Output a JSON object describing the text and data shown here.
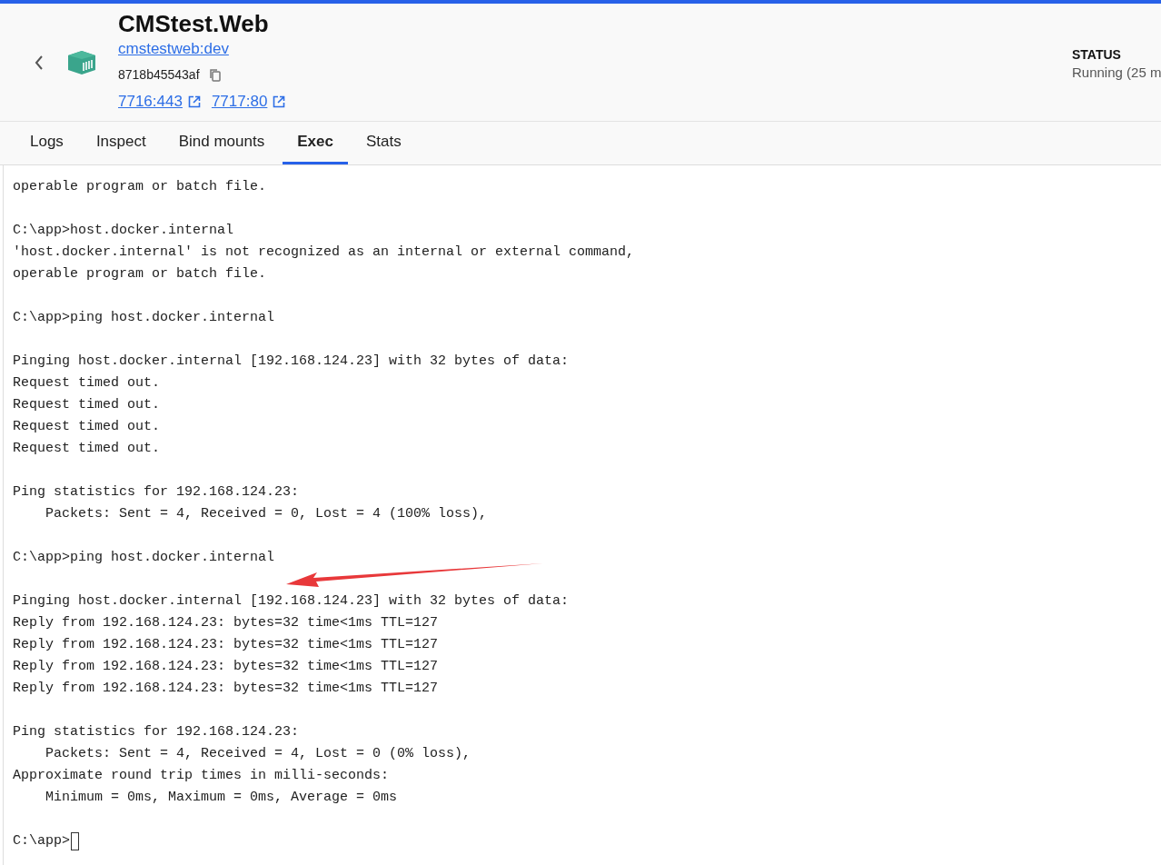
{
  "header": {
    "title": "CMStest.Web",
    "image_link": "cmstestweb:dev",
    "container_id": "8718b45543af",
    "ports": [
      "7716:443",
      "7717:80"
    ],
    "status_label": "STATUS",
    "status_value": "Running (25 m"
  },
  "tabs": [
    {
      "label": "Logs",
      "selected": false
    },
    {
      "label": "Inspect",
      "selected": false
    },
    {
      "label": "Bind mounts",
      "selected": false
    },
    {
      "label": "Exec",
      "selected": true
    },
    {
      "label": "Stats",
      "selected": false
    }
  ],
  "terminal": {
    "blocks": [
      [
        "operable program or batch file."
      ],
      [
        "C:\\app>host.docker.internal",
        "'host.docker.internal' is not recognized as an internal or external command,",
        "operable program or batch file."
      ],
      [
        "C:\\app>ping host.docker.internal"
      ],
      [
        "Pinging host.docker.internal [192.168.124.23] with 32 bytes of data:",
        "Request timed out.",
        "Request timed out.",
        "Request timed out.",
        "Request timed out."
      ],
      [
        "Ping statistics for 192.168.124.23:",
        "    Packets: Sent = 4, Received = 0, Lost = 4 (100% loss),"
      ],
      [
        "C:\\app>ping host.docker.internal"
      ],
      [
        "Pinging host.docker.internal [192.168.124.23] with 32 bytes of data:",
        "Reply from 192.168.124.23: bytes=32 time<1ms TTL=127",
        "Reply from 192.168.124.23: bytes=32 time<1ms TTL=127",
        "Reply from 192.168.124.23: bytes=32 time<1ms TTL=127",
        "Reply from 192.168.124.23: bytes=32 time<1ms TTL=127"
      ],
      [
        "Ping statistics for 192.168.124.23:",
        "    Packets: Sent = 4, Received = 4, Lost = 0 (0% loss),",
        "Approximate round trip times in milli-seconds:",
        "    Minimum = 0ms, Maximum = 0ms, Average = 0ms"
      ]
    ],
    "prompt": "C:\\app>"
  }
}
